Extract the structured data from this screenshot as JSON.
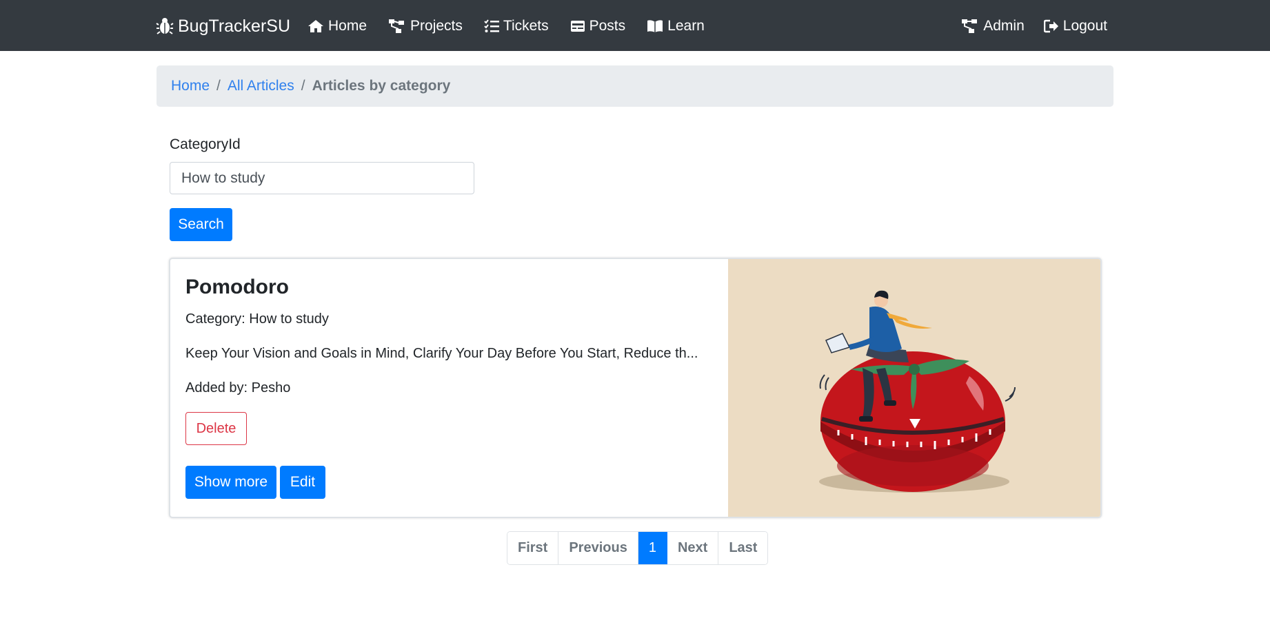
{
  "nav": {
    "brand": "BugTrackerSU",
    "items": [
      {
        "label": "Home",
        "icon": "home-icon"
      },
      {
        "label": "Projects",
        "icon": "sitemap-icon"
      },
      {
        "label": "Tickets",
        "icon": "tasks-icon"
      },
      {
        "label": "Posts",
        "icon": "card-icon"
      },
      {
        "label": "Learn",
        "icon": "book-icon"
      }
    ],
    "right_items": [
      {
        "label": "Admin",
        "icon": "sitemap-icon"
      },
      {
        "label": "Logout",
        "icon": "logout-icon"
      }
    ]
  },
  "breadcrumb": {
    "items": [
      "Home",
      "All Articles"
    ],
    "active": "Articles by category",
    "separator": "/"
  },
  "form": {
    "label": "CategoryId",
    "value": "How to study",
    "search_label": "Search"
  },
  "article": {
    "title": "Pomodoro",
    "category": "Category: How to study",
    "excerpt": "Keep Your Vision and Goals in Mind, Clarify Your Day Before You Start, Reduce th...",
    "added_by": "Added by: Pesho",
    "delete_label": "Delete",
    "show_more_label": "Show more",
    "edit_label": "Edit",
    "image_description": "pomodoro-tomato-timer-illustration"
  },
  "pagination": {
    "first": "First",
    "previous": "Previous",
    "current": "1",
    "next": "Next",
    "last": "Last"
  },
  "colors": {
    "navbar": "#343a40",
    "primary": "#007bff",
    "danger": "#dc3545",
    "breadcrumb_bg": "#e9ecef",
    "image_bg": "#ecdcc3"
  }
}
